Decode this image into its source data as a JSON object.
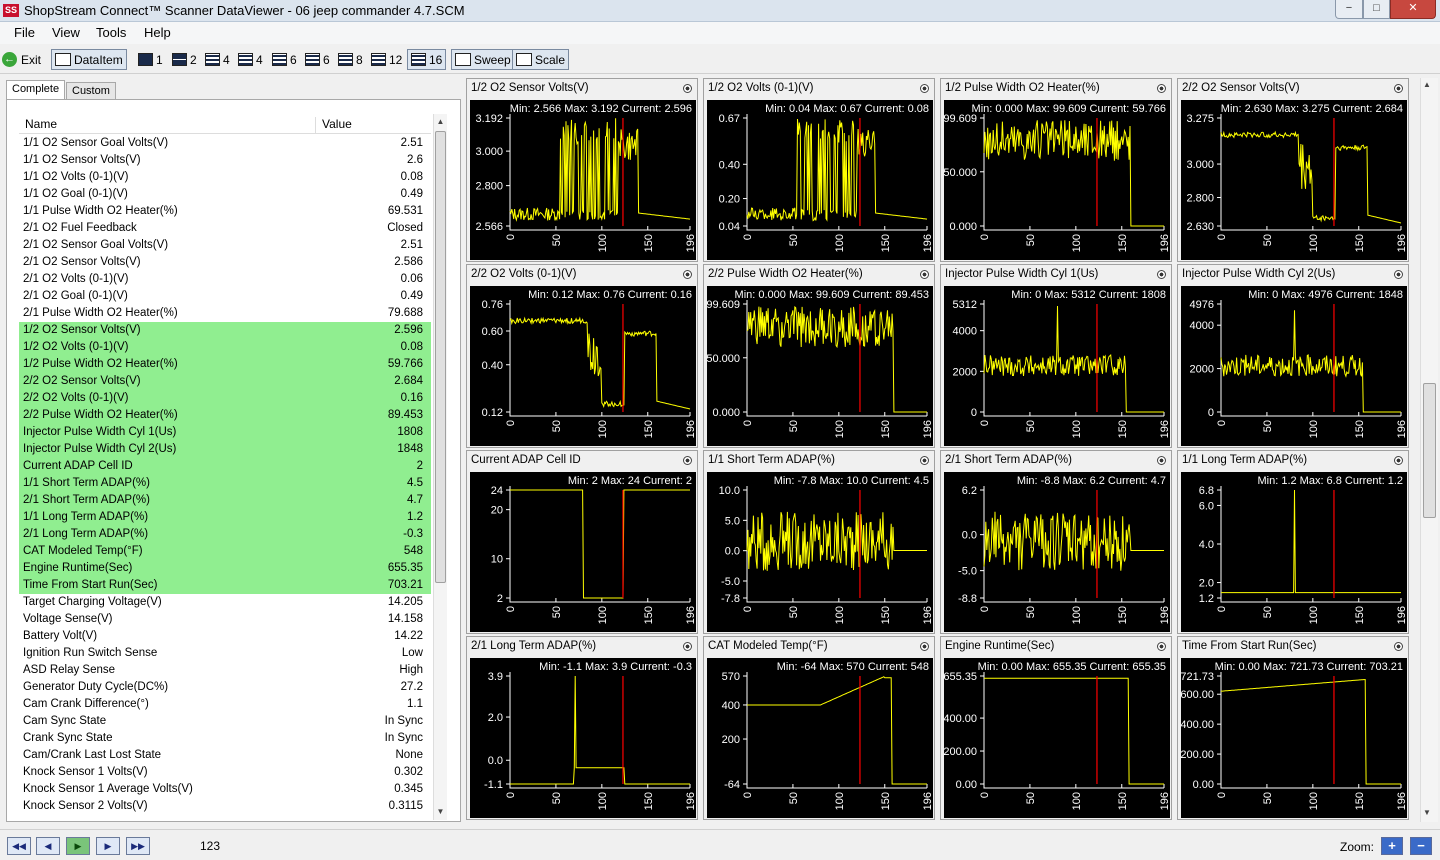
{
  "window": {
    "title": "ShopStream Connect™ Scanner DataViewer - 06 jeep commander 4.7.SCM",
    "app_icon": "SS",
    "min": "−",
    "max": "□",
    "close": "✕"
  },
  "menu": [
    "File",
    "View",
    "Tools",
    "Help"
  ],
  "toolbar": {
    "exit": "Exit",
    "dataitem": "DataItem",
    "layouts": [
      "1",
      "2",
      "4",
      "4",
      "6",
      "6",
      "8",
      "12",
      "16"
    ],
    "sweep": "Sweep",
    "scale": "Scale"
  },
  "tabs": {
    "complete": "Complete",
    "custom": "Custom"
  },
  "list": {
    "header_name": "Name",
    "header_value": "Value",
    "rows": [
      {
        "name": "1/1 O2 Sensor Goal Volts(V)",
        "value": "2.51",
        "hl": false
      },
      {
        "name": "1/1 O2 Sensor Volts(V)",
        "value": "2.6",
        "hl": false
      },
      {
        "name": "1/1 O2 Volts (0-1)(V)",
        "value": "0.08",
        "hl": false
      },
      {
        "name": "1/1 O2 Goal (0-1)(V)",
        "value": "0.49",
        "hl": false
      },
      {
        "name": "1/1 Pulse Width O2 Heater(%)",
        "value": "69.531",
        "hl": false
      },
      {
        "name": "2/1 O2 Fuel Feedback",
        "value": "Closed",
        "hl": false
      },
      {
        "name": "2/1 O2 Sensor Goal Volts(V)",
        "value": "2.51",
        "hl": false
      },
      {
        "name": "2/1 O2 Sensor Volts(V)",
        "value": "2.586",
        "hl": false
      },
      {
        "name": "2/1 O2 Volts (0-1)(V)",
        "value": "0.06",
        "hl": false
      },
      {
        "name": "2/1 O2 Goal (0-1)(V)",
        "value": "0.49",
        "hl": false
      },
      {
        "name": "2/1 Pulse Width O2 Heater(%)",
        "value": "79.688",
        "hl": false
      },
      {
        "name": "1/2 O2 Sensor Volts(V)",
        "value": "2.596",
        "hl": true
      },
      {
        "name": "1/2 O2 Volts (0-1)(V)",
        "value": "0.08",
        "hl": true
      },
      {
        "name": "1/2 Pulse Width O2 Heater(%)",
        "value": "59.766",
        "hl": true
      },
      {
        "name": "2/2 O2 Sensor Volts(V)",
        "value": "2.684",
        "hl": true
      },
      {
        "name": "2/2 O2 Volts (0-1)(V)",
        "value": "0.16",
        "hl": true
      },
      {
        "name": "2/2 Pulse Width O2 Heater(%)",
        "value": "89.453",
        "hl": true
      },
      {
        "name": "Injector Pulse Width Cyl 1(Us)",
        "value": "1808",
        "hl": true
      },
      {
        "name": "Injector Pulse Width Cyl 2(Us)",
        "value": "1848",
        "hl": true
      },
      {
        "name": "Current ADAP Cell ID",
        "value": "2",
        "hl": true
      },
      {
        "name": "1/1 Short Term ADAP(%)",
        "value": "4.5",
        "hl": true
      },
      {
        "name": "2/1 Short Term ADAP(%)",
        "value": "4.7",
        "hl": true
      },
      {
        "name": "1/1 Long Term ADAP(%)",
        "value": "1.2",
        "hl": true
      },
      {
        "name": "2/1 Long Term ADAP(%)",
        "value": "-0.3",
        "hl": true
      },
      {
        "name": "CAT Modeled Temp(°F)",
        "value": "548",
        "hl": true
      },
      {
        "name": "Engine Runtime(Sec)",
        "value": "655.35",
        "hl": true
      },
      {
        "name": "Time From Start Run(Sec)",
        "value": "703.21",
        "hl": true
      },
      {
        "name": "Target Charging Voltage(V)",
        "value": "14.205",
        "hl": false
      },
      {
        "name": "Voltage Sense(V)",
        "value": "14.158",
        "hl": false
      },
      {
        "name": "Battery Volt(V)",
        "value": "14.22",
        "hl": false
      },
      {
        "name": "Ignition Run Switch Sense",
        "value": "Low",
        "hl": false
      },
      {
        "name": "ASD Relay Sense",
        "value": "High",
        "hl": false
      },
      {
        "name": "Generator Duty Cycle(DC%)",
        "value": "27.2",
        "hl": false
      },
      {
        "name": "Cam Crank Difference(°)",
        "value": "1.1",
        "hl": false
      },
      {
        "name": "Cam Sync State",
        "value": "In Sync",
        "hl": false
      },
      {
        "name": "Crank Sync State",
        "value": "In Sync",
        "hl": false
      },
      {
        "name": "Cam/Crank Last Lost State",
        "value": "None",
        "hl": false
      },
      {
        "name": "Knock Sensor 1 Volts(V)",
        "value": "0.302",
        "hl": false
      },
      {
        "name": "Knock Sensor 1 Average Volts(V)",
        "value": "0.345",
        "hl": false
      },
      {
        "name": "Knock Sensor 2 Volts(V)",
        "value": "0.3115",
        "hl": false
      }
    ]
  },
  "graph_settings": {
    "xticks": [
      "0",
      "50",
      "100",
      "150",
      "196"
    ],
    "xmax": 196,
    "cursor_x": 123,
    "trace_color": "#ffff00",
    "cursor_color": "#ff0000",
    "bg": "#000000"
  },
  "chart_data": [
    {
      "type": "line",
      "title": "1/2 O2 Sensor Volts(V)",
      "min": "2.566",
      "max": "3.192",
      "current": "2.596",
      "ymin": 2.566,
      "ymax": 3.192,
      "yticks": [
        "3.192",
        "3.000",
        "2.800",
        "2.566"
      ],
      "yvals": [
        3.192,
        3.0,
        2.8,
        2.566
      ],
      "pattern": "o2s_high",
      "base": 2.6
    },
    {
      "type": "line",
      "title": "1/2 O2 Volts (0-1)(V)",
      "min": "0.04",
      "max": "0.67",
      "current": "0.08",
      "ymin": 0.04,
      "ymax": 0.67,
      "yticks": [
        "0.67",
        "0.40",
        "0.20",
        "0.04"
      ],
      "yvals": [
        0.67,
        0.4,
        0.2,
        0.04
      ],
      "pattern": "o2s_high",
      "base": 0.08
    },
    {
      "type": "line",
      "title": "1/2 Pulse Width O2 Heater(%)",
      "min": "0.000",
      "max": "99.609",
      "current": "59.766",
      "ymin": 0,
      "ymax": 99.609,
      "yticks": [
        "99.609",
        "50.000",
        "0.000"
      ],
      "yvals": [
        99.609,
        50,
        0
      ],
      "pattern": "heater",
      "base": 80
    },
    {
      "type": "line",
      "title": "2/2 O2 Sensor Volts(V)",
      "min": "2.630",
      "max": "3.275",
      "current": "2.684",
      "ymin": 2.63,
      "ymax": 3.275,
      "yticks": [
        "3.275",
        "3.000",
        "2.800",
        "2.630"
      ],
      "yvals": [
        3.275,
        3.0,
        2.8,
        2.63
      ],
      "pattern": "o2s_step",
      "base": 2.68
    },
    {
      "type": "line",
      "title": "2/2 O2 Volts (0-1)(V)",
      "min": "0.12",
      "max": "0.76",
      "current": "0.16",
      "ymin": 0.12,
      "ymax": 0.76,
      "yticks": [
        "0.76",
        "0.60",
        "0.40",
        "0.12"
      ],
      "yvals": [
        0.76,
        0.6,
        0.4,
        0.12
      ],
      "pattern": "o2s_step",
      "base": 0.15
    },
    {
      "type": "line",
      "title": "2/2 Pulse Width O2 Heater(%)",
      "min": "0.000",
      "max": "99.609",
      "current": "89.453",
      "ymin": 0,
      "ymax": 99.609,
      "yticks": [
        "99.609",
        "50.000",
        "0.000"
      ],
      "yvals": [
        99.609,
        50,
        0
      ],
      "pattern": "heater",
      "base": 75
    },
    {
      "type": "line",
      "title": "Injector Pulse Width Cyl 1(Us)",
      "min": "0",
      "max": "5312",
      "current": "1808",
      "ymin": 0,
      "ymax": 5312,
      "yticks": [
        "5312",
        "4000",
        "2000",
        "0"
      ],
      "yvals": [
        5312,
        4000,
        2000,
        0
      ],
      "pattern": "injector",
      "base": 2500
    },
    {
      "type": "line",
      "title": "Injector Pulse Width Cyl 2(Us)",
      "min": "0",
      "max": "4976",
      "current": "1848",
      "ymin": 0,
      "ymax": 4976,
      "yticks": [
        "4976",
        "4000",
        "2000",
        "0"
      ],
      "yvals": [
        4976,
        4000,
        2000,
        0
      ],
      "pattern": "injector",
      "base": 2500
    },
    {
      "type": "line",
      "title": "Current ADAP Cell ID",
      "min": "2",
      "max": "24",
      "current": "2",
      "ymin": 2,
      "ymax": 24,
      "yticks": [
        "24",
        "20",
        "10",
        "2"
      ],
      "yvals": [
        24,
        20,
        10,
        2
      ],
      "pattern": "adap_cell",
      "base": 24
    },
    {
      "type": "line",
      "title": "1/1 Short Term ADAP(%)",
      "min": "-7.8",
      "max": "10.0",
      "current": "4.5",
      "ymin": -7.8,
      "ymax": 10.0,
      "yticks": [
        "10.0",
        "5.0",
        "0.0",
        "-5.0",
        "-7.8"
      ],
      "yvals": [
        10,
        5,
        0,
        -5,
        -7.8
      ],
      "pattern": "short_term",
      "base": 0
    },
    {
      "type": "line",
      "title": "2/1 Short Term ADAP(%)",
      "min": "-8.8",
      "max": "6.2",
      "current": "4.7",
      "ymin": -8.8,
      "ymax": 6.2,
      "yticks": [
        "6.2",
        "0.0",
        "-5.0",
        "-8.8"
      ],
      "yvals": [
        6.2,
        0,
        -5,
        -8.8
      ],
      "pattern": "short_term",
      "base": 0
    },
    {
      "type": "line",
      "title": "1/1 Long Term ADAP(%)",
      "min": "1.2",
      "max": "6.8",
      "current": "1.2",
      "ymin": 1.2,
      "ymax": 6.8,
      "yticks": [
        "6.8",
        "6.0",
        "4.0",
        "2.0",
        "1.2"
      ],
      "yvals": [
        6.8,
        6,
        4,
        2,
        1.2
      ],
      "pattern": "long_term1",
      "base": 1.5
    },
    {
      "type": "line",
      "title": "2/1 Long Term ADAP(%)",
      "min": "-1.1",
      "max": "3.9",
      "current": "-0.3",
      "ymin": -1.1,
      "ymax": 3.9,
      "yticks": [
        "3.9",
        "2.0",
        "0.0",
        "-1.1"
      ],
      "yvals": [
        3.9,
        2,
        0,
        -1.1
      ],
      "pattern": "long_term2",
      "base": -1.1
    },
    {
      "type": "line",
      "title": "CAT Modeled Temp(°F)",
      "min": "-64",
      "max": "570",
      "current": "548",
      "ymin": -64,
      "ymax": 570,
      "yticks": [
        "570",
        "400",
        "200",
        "-64"
      ],
      "yvals": [
        570,
        400,
        200,
        -64
      ],
      "pattern": "cat_temp",
      "base": 400
    },
    {
      "type": "line",
      "title": "Engine Runtime(Sec)",
      "min": "0.00",
      "max": "655.35",
      "current": "655.35",
      "ymin": 0,
      "ymax": 655.35,
      "yticks": [
        "655.35",
        "400.00",
        "200.00",
        "0.00"
      ],
      "yvals": [
        655.35,
        400,
        200,
        0
      ],
      "pattern": "runtime",
      "base": 640
    },
    {
      "type": "line",
      "title": "Time From Start Run(Sec)",
      "min": "0.00",
      "max": "721.73",
      "current": "703.21",
      "ymin": 0,
      "ymax": 721.73,
      "yticks": [
        "721.73",
        "600.00",
        "400.00",
        "200.00",
        "0.00"
      ],
      "yvals": [
        721.73,
        600,
        400,
        200,
        0
      ],
      "pattern": "timerun",
      "base": 600
    }
  ],
  "status": {
    "frame": "123",
    "zoom_label": "Zoom:",
    "zoom_in": "+",
    "zoom_out": "−",
    "nav": [
      "◀◀",
      "◀",
      "▶",
      "▶",
      "▶▶"
    ]
  }
}
